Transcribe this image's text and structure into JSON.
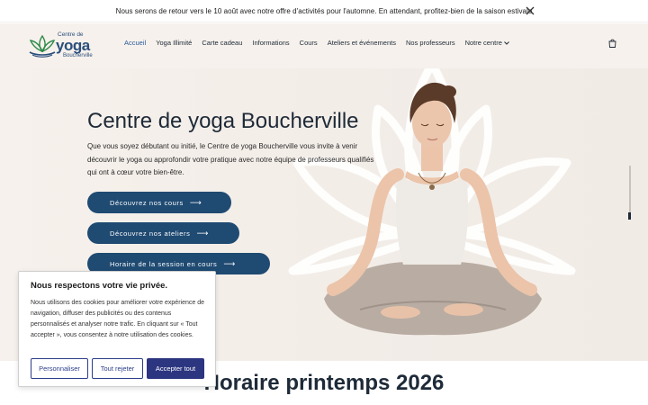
{
  "announcement": {
    "text": "Nous serons de retour vers le 10 août avec notre offre d'activités pour l'automne. En attendant, profitez-bien de la saison estivale",
    "close_icon": "close-icon"
  },
  "logo": {
    "line1": "Centre de",
    "line2": "yoga",
    "line3": "Boucherville"
  },
  "nav": {
    "items": [
      {
        "label": "Accueil",
        "active": true
      },
      {
        "label": "Yoga Illimité"
      },
      {
        "label": "Carte cadeau"
      },
      {
        "label": "Informations"
      },
      {
        "label": "Cours"
      },
      {
        "label": "Ateliers et événements"
      },
      {
        "label": "Nos professeurs"
      },
      {
        "label": "Notre centre",
        "has_dropdown": true
      }
    ],
    "cart_icon": "cart-icon"
  },
  "hero": {
    "title": "Centre de yoga Boucherville",
    "description": "Que vous soyez débutant ou initié, le Centre de yoga Boucherville vous invite à venir découvrir le yoga ou approfondir votre pratique avec notre équipe de professeurs qualifiés qui ont à cœur votre bien-être.",
    "ctas": [
      {
        "label": "Découvrez nos cours"
      },
      {
        "label": "Découvrez nos ateliers"
      },
      {
        "label": "Horaire de la session en cours"
      }
    ]
  },
  "section": {
    "title": "Horaire printemps 2026"
  },
  "cookie": {
    "title": "Nous respectons votre vie privée.",
    "body": "Nous utilisons des cookies pour améliorer votre expérience de navigation, diffuser des publicités ou des contenus personnalisés et analyser notre trafic. En cliquant sur « Tout accepter », vous consentez à notre utilisation des cookies.",
    "customize_label": "Personnaliser",
    "reject_label": "Tout rejeter",
    "accept_label": "Accepter tout"
  },
  "colors": {
    "brand": "#1f4a72",
    "accent_nav": "#2a5a9c",
    "cookie_button": "#2c3580",
    "hero_bg": "#f6f1ec"
  }
}
